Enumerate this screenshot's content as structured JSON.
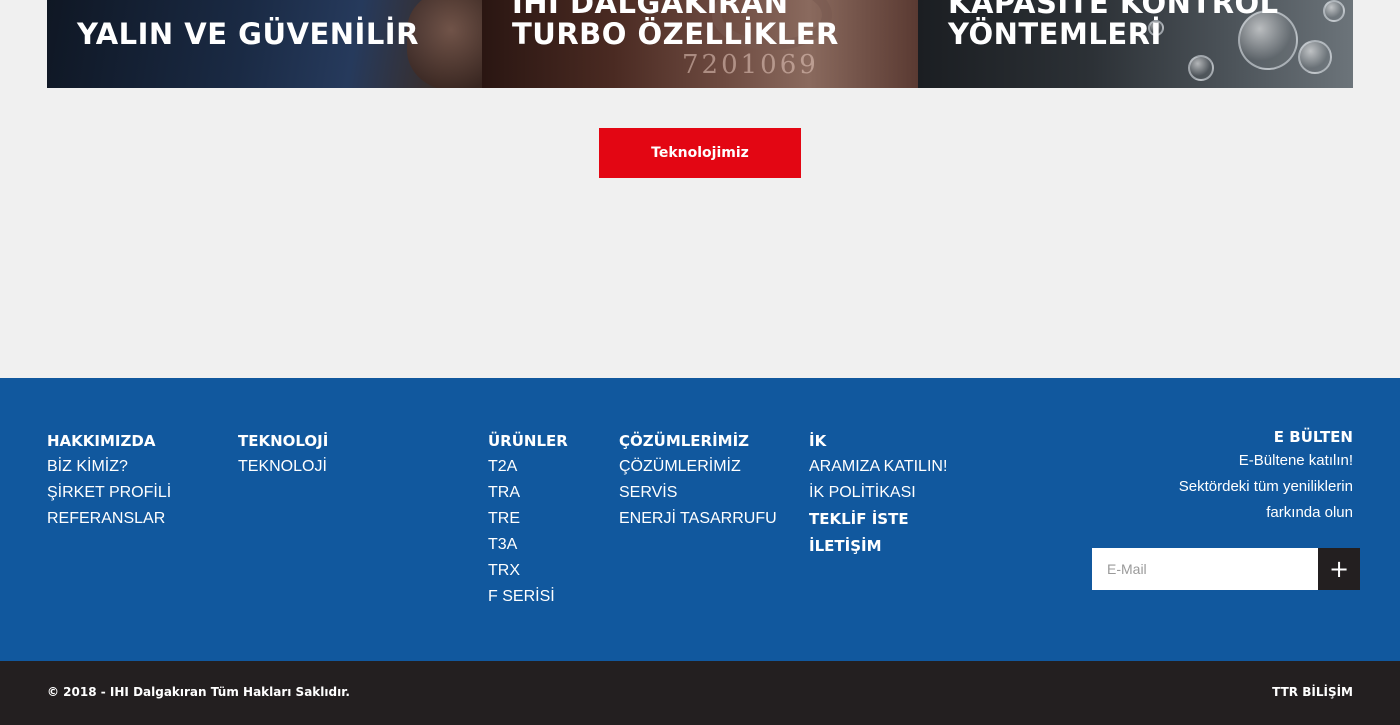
{
  "hero": {
    "tiles": [
      {
        "line1": "YALIN VE GÜVENİLİR",
        "line2": ""
      },
      {
        "line1": "IHI DALGAKIRAN",
        "line2": "TURBO ÖZELLİKLER",
        "stamp": "7201069"
      },
      {
        "line1": "KAPASİTE KONTROL",
        "line2": "YÖNTEMLERİ"
      }
    ]
  },
  "cta": {
    "label": "Teknolojimiz"
  },
  "footer": {
    "columns": [
      {
        "title": "HAKKIMIZDA",
        "links": [
          "BİZ KİMİZ?",
          "ŞİRKET PROFİLİ",
          "REFERANSLAR"
        ]
      },
      {
        "title": "TEKNOLOJİ",
        "links": [
          "TEKNOLOJİ"
        ]
      },
      {
        "title": "ÜRÜNLER",
        "links": [
          "T2A",
          "TRA",
          "TRE",
          "T3A",
          "TRX",
          "F SERİSİ"
        ]
      },
      {
        "title": "ÇÖZÜMLERİMİZ",
        "links": [
          "ÇÖZÜMLERİMİZ",
          "SERVİS",
          "ENERJİ TASARRUFU"
        ]
      },
      {
        "title": "İK",
        "links": [
          "ARAMIZA KATILIN!",
          "İK POLİTİKASI"
        ],
        "bold_links": [
          "TEKLİF İSTE",
          "İLETİŞİM"
        ]
      }
    ],
    "newsletter": {
      "title": "E BÜLTEN",
      "line1": "E-Bültene katılın!",
      "line2": "Sektördeki tüm yeniliklerin",
      "line3": "farkında olun",
      "placeholder": "E-Mail",
      "submit_icon": "plus-icon",
      "submit_symbol": "+"
    }
  },
  "bottom": {
    "copyright": "© 2018 - IHI Dalgakıran Tüm Hakları Saklıdır.",
    "credit": "TTR BİLİŞİM"
  },
  "colors": {
    "background": "#f0f0f0",
    "cta_red": "#e30613",
    "footer_blue": "#11589e",
    "bottom_dark": "#231f20"
  }
}
